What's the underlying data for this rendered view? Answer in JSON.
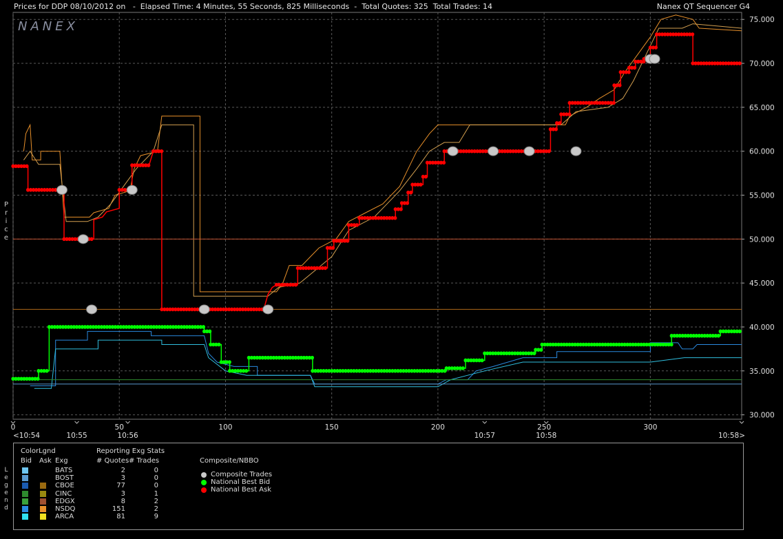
{
  "header": {
    "title": "Prices for DDP 08/10/2012 on   -  Elapsed Time: 4 Minutes, 55 Seconds, 825 Milliseconds  -  Total Quotes: 325  Total Trades: 14",
    "app_name": "Nanex QT Sequencer G4",
    "logo": "NANEX"
  },
  "y_axis_label": "Price",
  "legend_side_label": "Legend",
  "chart_data": {
    "type": "line",
    "ylim": [
      29.5,
      75.8
    ],
    "xlim": [
      0,
      343
    ],
    "y_ticks": [
      "30.000",
      "35.000",
      "40.000",
      "45.000",
      "50.000",
      "55.000",
      "60.000",
      "65.000",
      "70.000",
      "75.000"
    ],
    "y_tick_values": [
      30,
      35,
      40,
      45,
      50,
      55,
      60,
      65,
      70,
      75
    ],
    "x_ticks": [
      "0",
      "50",
      "100",
      "150",
      "200",
      "250",
      "300"
    ],
    "x_tick_values": [
      0,
      50,
      100,
      150,
      200,
      250,
      300
    ],
    "time_labels": [
      {
        "label": "<10:54",
        "x": 0
      },
      {
        "label": "10:55",
        "x": 30
      },
      {
        "label": "10:56",
        "x": 54
      },
      {
        "label": "10:57",
        "x": 222
      },
      {
        "label": "10:58",
        "x": 251
      },
      {
        "label": "10:58>",
        "x": 343
      }
    ],
    "grid": true,
    "series": [
      {
        "name": "National Best Ask",
        "color": "#ff0000",
        "points": [
          [
            0,
            58.3
          ],
          [
            7,
            58.3
          ],
          [
            7,
            55.6
          ],
          [
            22,
            55.6
          ],
          [
            24,
            55.6
          ],
          [
            24,
            50
          ],
          [
            38,
            50
          ],
          [
            38,
            52.2
          ],
          [
            42,
            52.5
          ],
          [
            44,
            53.1
          ],
          [
            47,
            53.3
          ],
          [
            50,
            53.5
          ],
          [
            50,
            55.6
          ],
          [
            56,
            55.6
          ],
          [
            56,
            58.4
          ],
          [
            64,
            58.4
          ],
          [
            66,
            60
          ],
          [
            70,
            60
          ],
          [
            70,
            42
          ],
          [
            90,
            42
          ],
          [
            90,
            42
          ],
          [
            118,
            42
          ],
          [
            120,
            43.7
          ],
          [
            122,
            44.5
          ],
          [
            124,
            44.8
          ],
          [
            134,
            44.8
          ],
          [
            134,
            46.7
          ],
          [
            148,
            46.7
          ],
          [
            148,
            49
          ],
          [
            151,
            49
          ],
          [
            151,
            49.8
          ],
          [
            158,
            49.8
          ],
          [
            158,
            51.6
          ],
          [
            163,
            51.6
          ],
          [
            163,
            52.4
          ],
          [
            180,
            52.4
          ],
          [
            180,
            53.4
          ],
          [
            183,
            53.4
          ],
          [
            183,
            54.1
          ],
          [
            186,
            54.1
          ],
          [
            186,
            55.3
          ],
          [
            188,
            55.3
          ],
          [
            188,
            56.2
          ],
          [
            193,
            56.2
          ],
          [
            193,
            57.1
          ],
          [
            195,
            57.1
          ],
          [
            195,
            58.7
          ],
          [
            203,
            58.7
          ],
          [
            203,
            60
          ],
          [
            253,
            60
          ],
          [
            253,
            62.5
          ],
          [
            256,
            62.5
          ],
          [
            256,
            63.2
          ],
          [
            258,
            63.2
          ],
          [
            258,
            64.2
          ],
          [
            262,
            64.2
          ],
          [
            262,
            65.5
          ],
          [
            283,
            65.5
          ],
          [
            283,
            67.5
          ],
          [
            286,
            67.5
          ],
          [
            286,
            69.0
          ],
          [
            290,
            69.0
          ],
          [
            290,
            69.5
          ],
          [
            293,
            69.5
          ],
          [
            293,
            70.2
          ],
          [
            297,
            70.2
          ],
          [
            297,
            70.5
          ],
          [
            300,
            70.5
          ],
          [
            300,
            71.8
          ],
          [
            303,
            71.8
          ],
          [
            303,
            73.3
          ],
          [
            320,
            73.3
          ],
          [
            320,
            70
          ],
          [
            343,
            70
          ]
        ],
        "markers": true
      },
      {
        "name": "National Best Bid",
        "color": "#00ff00",
        "points": [
          [
            0,
            34.1
          ],
          [
            12,
            34.1
          ],
          [
            12,
            35
          ],
          [
            17,
            35
          ],
          [
            17,
            40
          ],
          [
            90,
            40
          ],
          [
            90,
            39.5
          ],
          [
            93,
            39.5
          ],
          [
            93,
            38
          ],
          [
            98,
            38
          ],
          [
            98,
            36
          ],
          [
            102,
            36
          ],
          [
            102,
            35
          ],
          [
            111,
            35
          ],
          [
            111,
            36.5
          ],
          [
            141,
            36.5
          ],
          [
            141,
            35
          ],
          [
            204,
            35
          ],
          [
            204,
            35.3
          ],
          [
            213,
            35.3
          ],
          [
            213,
            36.2
          ],
          [
            222,
            36.2
          ],
          [
            222,
            37
          ],
          [
            246,
            37
          ],
          [
            246,
            37.4
          ],
          [
            249,
            37.4
          ],
          [
            249,
            38
          ],
          [
            310,
            38
          ],
          [
            310,
            39
          ],
          [
            333,
            39
          ],
          [
            333,
            39.5
          ],
          [
            343,
            39.5
          ]
        ],
        "markers": true
      }
    ],
    "exchange_lines": [
      {
        "exchange": "NSDQ Ask",
        "color": "#e8902a",
        "points": [
          [
            5,
            60
          ],
          [
            6,
            62
          ],
          [
            8,
            63
          ],
          [
            9,
            59
          ],
          [
            13,
            59
          ],
          [
            13,
            60
          ],
          [
            22,
            60
          ],
          [
            24,
            52.5
          ],
          [
            36,
            52.5
          ],
          [
            38,
            53
          ],
          [
            45,
            53.5
          ],
          [
            48,
            55
          ],
          [
            55,
            55.5
          ],
          [
            57,
            58
          ],
          [
            60,
            59.5
          ],
          [
            68,
            60
          ],
          [
            70,
            64
          ],
          [
            88,
            64
          ],
          [
            88,
            44
          ],
          [
            124,
            44
          ],
          [
            127,
            45
          ],
          [
            130,
            47
          ],
          [
            136,
            47
          ],
          [
            140,
            48
          ],
          [
            144,
            49
          ],
          [
            152,
            50
          ],
          [
            158,
            52
          ],
          [
            166,
            53
          ],
          [
            174,
            54
          ],
          [
            178,
            55
          ],
          [
            182,
            56
          ],
          [
            186,
            58
          ],
          [
            190,
            60
          ],
          [
            196,
            62
          ],
          [
            200,
            63
          ],
          [
            260,
            63
          ],
          [
            262,
            64
          ],
          [
            270,
            65
          ],
          [
            276,
            66
          ],
          [
            283,
            67
          ],
          [
            288,
            69
          ],
          [
            294,
            71
          ],
          [
            300,
            73
          ],
          [
            305,
            75
          ],
          [
            312,
            75.5
          ],
          [
            320,
            75
          ],
          [
            323,
            74
          ],
          [
            343,
            73.7
          ]
        ]
      },
      {
        "exchange": "ARCA Ask",
        "color": "#d4a050",
        "points": [
          [
            5,
            59
          ],
          [
            8,
            60
          ],
          [
            12,
            58.5
          ],
          [
            22,
            58.5
          ],
          [
            25,
            52
          ],
          [
            35,
            52
          ],
          [
            40,
            52.5
          ],
          [
            46,
            54
          ],
          [
            52,
            56
          ],
          [
            58,
            58
          ],
          [
            66,
            60
          ],
          [
            70,
            63
          ],
          [
            85,
            63
          ],
          [
            85,
            43.5
          ],
          [
            120,
            43.5
          ],
          [
            125,
            44.5
          ],
          [
            135,
            45
          ],
          [
            145,
            47
          ],
          [
            150,
            48
          ],
          [
            158,
            51
          ],
          [
            170,
            52.5
          ],
          [
            176,
            54
          ],
          [
            182,
            55.5
          ],
          [
            190,
            58
          ],
          [
            196,
            60
          ],
          [
            203,
            61
          ],
          [
            210,
            61
          ],
          [
            215,
            63
          ],
          [
            258,
            63
          ],
          [
            265,
            64.5
          ],
          [
            280,
            65
          ],
          [
            287,
            66
          ],
          [
            292,
            68
          ],
          [
            298,
            71
          ],
          [
            304,
            74
          ],
          [
            315,
            74
          ],
          [
            320,
            74.5
          ],
          [
            343,
            74
          ]
        ]
      },
      {
        "exchange": "CBOE Ask",
        "color": "#b06a1a",
        "points": [
          [
            0,
            42
          ],
          [
            343,
            42
          ]
        ]
      },
      {
        "exchange": "EDGX Ask",
        "color": "#c05030",
        "points": [
          [
            0,
            50
          ],
          [
            343,
            50
          ]
        ]
      },
      {
        "exchange": "NSDQ Bid",
        "color": "#2a8ae0",
        "points": [
          [
            8,
            33.3
          ],
          [
            20,
            33.3
          ],
          [
            20,
            38.5
          ],
          [
            35,
            38.5
          ],
          [
            35,
            39.5
          ],
          [
            65,
            39.5
          ],
          [
            65,
            39
          ],
          [
            80,
            39
          ],
          [
            80,
            39
          ],
          [
            90,
            39
          ],
          [
            92,
            37
          ],
          [
            96,
            36
          ],
          [
            104,
            35.5
          ],
          [
            115,
            35.5
          ],
          [
            115,
            34.5
          ],
          [
            140,
            34.5
          ],
          [
            142,
            33.5
          ],
          [
            200,
            33.5
          ],
          [
            204,
            34
          ],
          [
            214,
            34
          ],
          [
            218,
            35
          ],
          [
            226,
            35.5
          ],
          [
            240,
            36.5
          ],
          [
            256,
            36.5
          ],
          [
            256,
            37.2
          ],
          [
            300,
            37.2
          ],
          [
            300,
            38.2
          ],
          [
            313,
            38.2
          ],
          [
            315,
            37.5
          ],
          [
            320,
            37.5
          ],
          [
            322,
            38
          ],
          [
            343,
            38
          ]
        ]
      },
      {
        "exchange": "ARCA Bid",
        "color": "#30c0e0",
        "points": [
          [
            10,
            33
          ],
          [
            18,
            33
          ],
          [
            20,
            37.5
          ],
          [
            40,
            37.5
          ],
          [
            40,
            38.5
          ],
          [
            70,
            38.5
          ],
          [
            70,
            38
          ],
          [
            90,
            38
          ],
          [
            92,
            36.5
          ],
          [
            100,
            35
          ],
          [
            110,
            34.5
          ],
          [
            140,
            34.5
          ],
          [
            142,
            33.2
          ],
          [
            200,
            33.2
          ],
          [
            206,
            34
          ],
          [
            214,
            34.5
          ],
          [
            222,
            35
          ],
          [
            240,
            36
          ],
          [
            300,
            36
          ],
          [
            316,
            36.5
          ],
          [
            343,
            36.5
          ]
        ]
      },
      {
        "exchange": "BOST Bid",
        "color": "#5a9ad0",
        "points": [
          [
            0,
            33.5
          ],
          [
            343,
            33.5
          ]
        ]
      },
      {
        "exchange": "CINC Bid",
        "color": "#2e8b2e",
        "points": [
          [
            0,
            34
          ],
          [
            343,
            34
          ]
        ]
      }
    ],
    "composite_trades": [
      [
        23,
        55.6
      ],
      [
        33,
        50
      ],
      [
        37,
        42
      ],
      [
        56,
        55.6
      ],
      [
        90,
        42
      ],
      [
        120,
        42
      ],
      [
        207,
        60
      ],
      [
        226,
        60
      ],
      [
        243,
        60
      ],
      [
        265,
        60
      ],
      [
        300,
        70.5
      ],
      [
        302,
        70.5
      ]
    ]
  },
  "legend": {
    "color_legend_label": "ColorLgnd",
    "bid_label": "Bid",
    "ask_label": "Ask",
    "exg_label": "Exg",
    "stats_label": "Reporting Exg Stats",
    "quotes_label": "# Quotes",
    "trades_label": "# Trades",
    "composite_label": "Composite/NBBO",
    "rows": [
      {
        "exg": "BATS",
        "quotes": "2",
        "trades": "0",
        "bid_color": "#6ec6f0",
        "ask_color": ""
      },
      {
        "exg": "BOST",
        "quotes": "3",
        "trades": "0",
        "bid_color": "#5a9ad0",
        "ask_color": ""
      },
      {
        "exg": "CBOE",
        "quotes": "77",
        "trades": "0",
        "bid_color": "#1a5ab0",
        "ask_color": "#9a6a10"
      },
      {
        "exg": "CINC",
        "quotes": "3",
        "trades": "1",
        "bid_color": "#2e8b2e",
        "ask_color": "#9a8a10"
      },
      {
        "exg": "EDGX",
        "quotes": "8",
        "trades": "2",
        "bid_color": "#3aa03a",
        "ask_color": "#a05030"
      },
      {
        "exg": "NSDQ",
        "quotes": "151",
        "trades": "2",
        "bid_color": "#2a8ae0",
        "ask_color": "#e8902a"
      },
      {
        "exg": "ARCA",
        "quotes": "81",
        "trades": "9",
        "bid_color": "#30e0f0",
        "ask_color": "#f0e020"
      }
    ],
    "composite_items": [
      {
        "label": "Composite Trades",
        "color": "#c8c8c8"
      },
      {
        "label": "National Best Bid",
        "color": "#00ff00"
      },
      {
        "label": "National Best Ask",
        "color": "#ff0000"
      }
    ]
  }
}
